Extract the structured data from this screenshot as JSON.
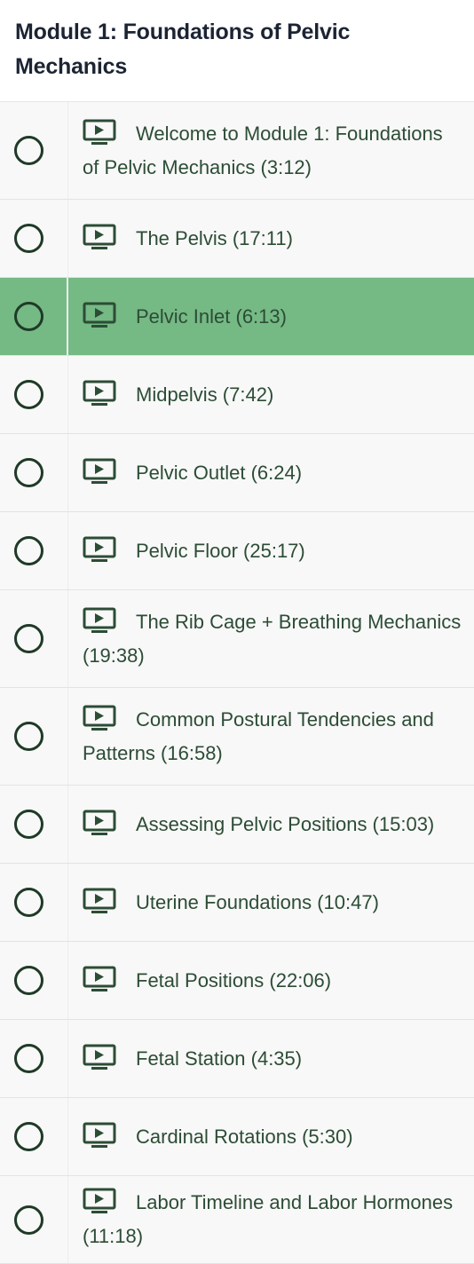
{
  "module": {
    "title": "Module 1: Foundations of Pelvic Mechanics"
  },
  "colors": {
    "active_row": "#75b985",
    "row_background": "#f8f8f8",
    "text": "#2c4c35",
    "icon": "#2c4c35"
  },
  "lessons": [
    {
      "label": "Welcome to Module 1: Foundations of Pelvic Mechanics (3:12)",
      "icon": "video-icon",
      "completed": false,
      "active": false
    },
    {
      "label": "The Pelvis (17:11)",
      "icon": "video-icon",
      "completed": false,
      "active": false
    },
    {
      "label": "Pelvic Inlet (6:13)",
      "icon": "video-icon",
      "completed": false,
      "active": true
    },
    {
      "label": "Midpelvis (7:42)",
      "icon": "video-icon",
      "completed": false,
      "active": false
    },
    {
      "label": "Pelvic Outlet (6:24)",
      "icon": "video-icon",
      "completed": false,
      "active": false
    },
    {
      "label": "Pelvic Floor (25:17)",
      "icon": "video-icon",
      "completed": false,
      "active": false
    },
    {
      "label": "The Rib Cage + Breathing Mechanics (19:38)",
      "icon": "video-icon",
      "completed": false,
      "active": false
    },
    {
      "label": "Common Postural Tendencies and Patterns (16:58)",
      "icon": "video-icon",
      "completed": false,
      "active": false
    },
    {
      "label": "Assessing Pelvic Positions (15:03)",
      "icon": "video-icon",
      "completed": false,
      "active": false
    },
    {
      "label": "Uterine Foundations (10:47)",
      "icon": "video-icon",
      "completed": false,
      "active": false
    },
    {
      "label": "Fetal Positions (22:06)",
      "icon": "video-icon",
      "completed": false,
      "active": false
    },
    {
      "label": "Fetal Station (4:35)",
      "icon": "video-icon",
      "completed": false,
      "active": false
    },
    {
      "label": "Cardinal Rotations (5:30)",
      "icon": "video-icon",
      "completed": false,
      "active": false
    },
    {
      "label": "Labor Timeline and Labor Hormones (11:18)",
      "icon": "video-icon",
      "completed": false,
      "active": false
    }
  ]
}
